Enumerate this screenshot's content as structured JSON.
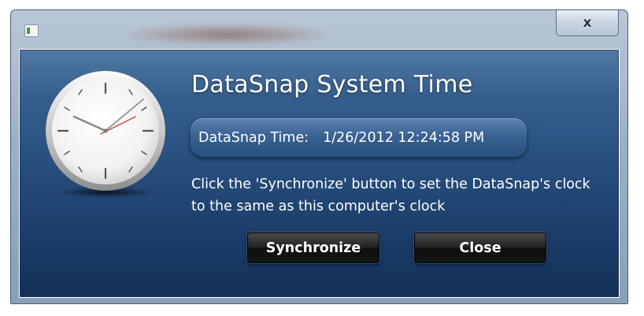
{
  "window": {
    "close_glyph": "x",
    "icon": "app-icon"
  },
  "dialog": {
    "title": "DataSnap System Time",
    "time_label": "DataSnap Time:",
    "time_value": "1/26/2012 12:24:58 PM",
    "instructions": "Click the 'Synchronize' button to set the DataSnap's clock to the same as this computer's clock",
    "synchronize_label": "Synchronize",
    "close_label": "Close",
    "clock_icon": "clock-icon"
  },
  "clock": {
    "time_shown": "12:24"
  },
  "colors": {
    "panel_top": "#3e6998",
    "panel_bottom": "#132f57",
    "second_hand": "#d0463a",
    "button_dark": "#161616"
  }
}
